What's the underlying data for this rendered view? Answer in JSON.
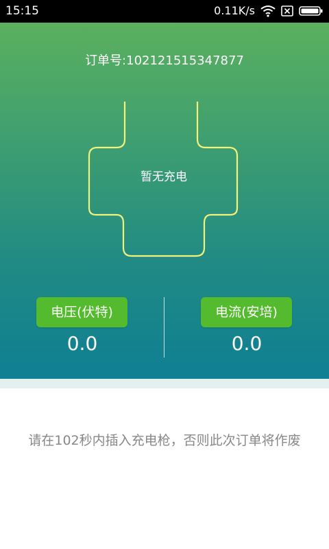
{
  "status_bar": {
    "time": "15:15",
    "network_speed": "0.11K/s",
    "icons": [
      "wifi-icon",
      "sim-none-icon",
      "battery-icon"
    ]
  },
  "order": {
    "label": "订单号:102121515347877"
  },
  "plug": {
    "status": "暂无充电",
    "outline_color": "#f4f27a"
  },
  "voltage": {
    "label": "电压(伏特)",
    "value": "0.0"
  },
  "current": {
    "label": "电流(安培)",
    "value": "0.0"
  },
  "notice": {
    "text": "请在102秒内插入充电枪，否则此次订单将作废"
  },
  "colors": {
    "gradient_top": "#5bb05e",
    "gradient_bottom": "#0f7f93",
    "button_green": "#54bb2e",
    "notice_gray": "#888888"
  }
}
